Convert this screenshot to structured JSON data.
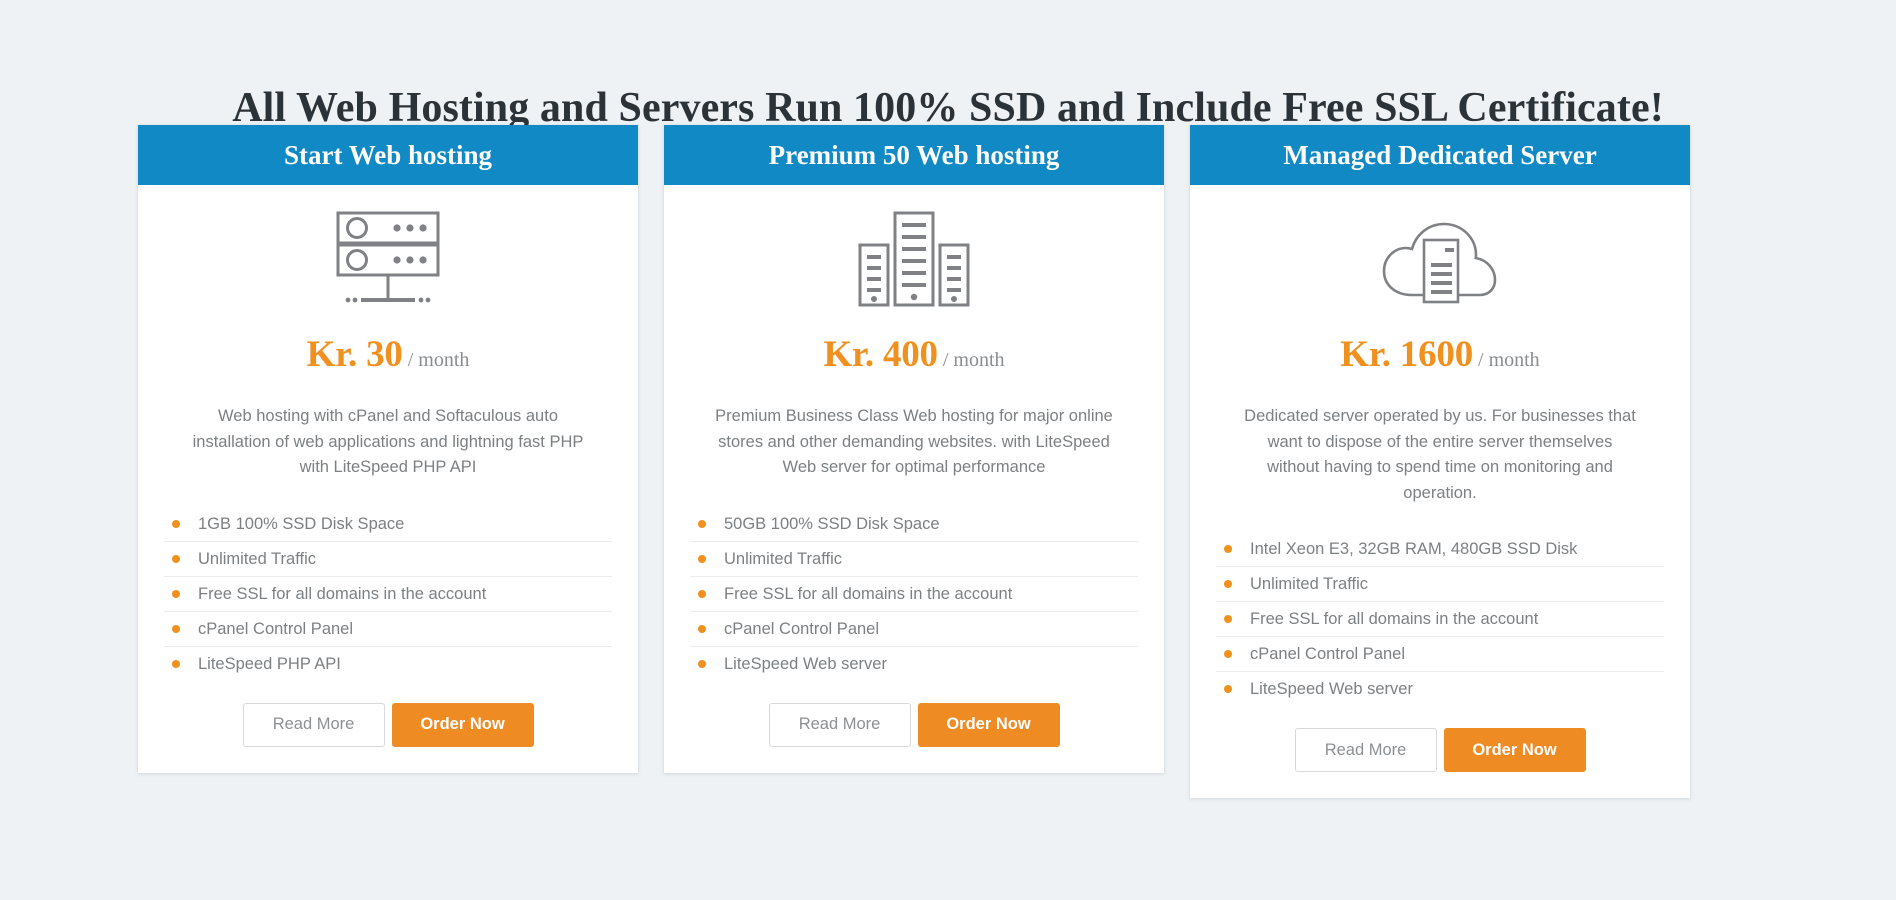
{
  "page": {
    "heading": "All Web Hosting and Servers Run 100% SSD and Include Free SSL Certificate!",
    "background_color": "#eef2f5",
    "accent_color": "#f0901e",
    "header_color": "#1189c4",
    "body_text_color": "#7d8083"
  },
  "cards": [
    {
      "title": "Start Web hosting",
      "icon": "server-rack-icon",
      "price_amount": "Kr. 30",
      "price_period": "/ month",
      "description": "Web hosting with cPanel and Softaculous auto installation of web applications and lightning fast PHP with LiteSpeed PHP API",
      "features": [
        "1GB 100% SSD Disk Space",
        "Unlimited Traffic",
        "Free SSL for all domains in the account",
        "cPanel Control Panel",
        "LiteSpeed PHP API"
      ],
      "read_more_label": "Read More",
      "order_now_label": "Order Now"
    },
    {
      "title": "Premium 50 Web hosting",
      "icon": "server-towers-icon",
      "price_amount": "Kr. 400",
      "price_period": "/ month",
      "description": "Premium Business Class Web hosting for major online stores and other demanding websites. with LiteSpeed Web server for optimal performance",
      "features": [
        "50GB 100% SSD Disk Space",
        "Unlimited Traffic",
        "Free SSL for all domains in the account",
        "cPanel Control Panel",
        "LiteSpeed Web server"
      ],
      "read_more_label": "Read More",
      "order_now_label": "Order Now"
    },
    {
      "title": "Managed Dedicated Server",
      "icon": "cloud-server-icon",
      "price_amount": "Kr. 1600",
      "price_period": "/ month",
      "description": "Dedicated server operated by us. For businesses that want to dispose of the entire server themselves without having to spend time on monitoring and operation.",
      "features": [
        "Intel Xeon E3, 32GB RAM, 480GB SSD Disk",
        "Unlimited Traffic",
        "Free SSL for all domains in the account",
        "cPanel Control Panel",
        "LiteSpeed Web server"
      ],
      "read_more_label": "Read More",
      "order_now_label": "Order Now"
    }
  ]
}
